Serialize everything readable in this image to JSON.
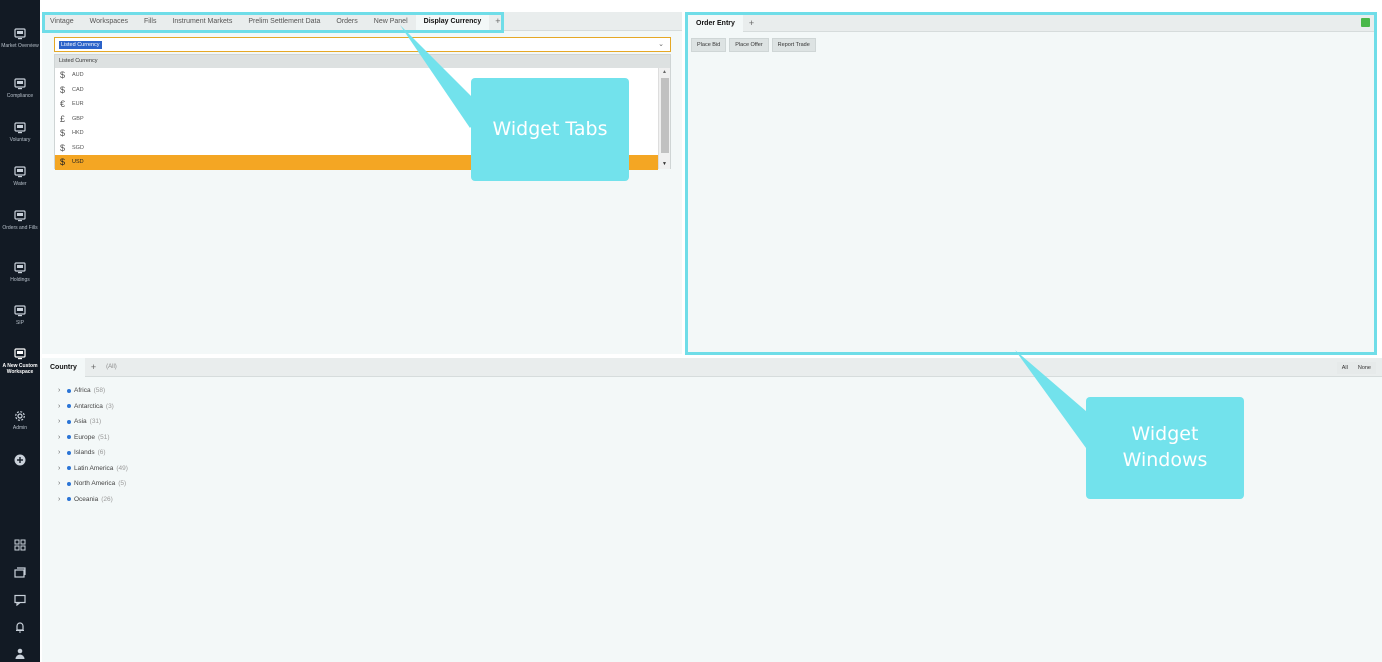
{
  "sidebar": {
    "items": [
      {
        "label": "Market Overview",
        "icon": "monitor-icon"
      },
      {
        "label": "Compliance",
        "icon": "monitor-icon"
      },
      {
        "label": "Voluntary",
        "icon": "monitor-icon"
      },
      {
        "label": "Water",
        "icon": "monitor-icon"
      },
      {
        "label": "Orders and Fills",
        "icon": "monitor-icon"
      },
      {
        "label": "Holdings",
        "icon": "monitor-icon"
      },
      {
        "label": "SIP",
        "icon": "monitor-icon"
      },
      {
        "label": "A New Custom Workspace",
        "icon": "monitor-icon",
        "active": true
      },
      {
        "label": "Admin",
        "icon": "gear-icon"
      }
    ],
    "bottom_icons": [
      "grid-icon",
      "windows-icon",
      "chat-icon",
      "bell-icon",
      "user-icon"
    ]
  },
  "left_panel": {
    "tabs": [
      "Vintage",
      "Workspaces",
      "Fills",
      "Instrument Markets",
      "Prelim Settlement Data",
      "Orders",
      "New Panel",
      "Display Currency"
    ],
    "active_tab": "Display Currency",
    "add_tab": "+",
    "select_value": "Listed Currency",
    "dropdown_header": "Listed Currency",
    "options": [
      {
        "symbol": "$",
        "code": "AUD"
      },
      {
        "symbol": "$",
        "code": "CAD"
      },
      {
        "symbol": "€",
        "code": "EUR"
      },
      {
        "symbol": "£",
        "code": "GBP"
      },
      {
        "symbol": "$",
        "code": "HKD"
      },
      {
        "symbol": "$",
        "code": "SGD"
      },
      {
        "symbol": "$",
        "code": "USD",
        "selected": true
      }
    ]
  },
  "right_panel": {
    "tab": "Order Entry",
    "add_tab": "+",
    "buttons": [
      "Place Bid",
      "Place Offer",
      "Report Trade"
    ]
  },
  "bottom_panel": {
    "tab": "Country",
    "add_tab": "+",
    "all_count": "(All)",
    "all_label": "All",
    "none_label": "None",
    "regions": [
      {
        "name": "Africa",
        "count": "(58)"
      },
      {
        "name": "Antarctica",
        "count": "(3)"
      },
      {
        "name": "Asia",
        "count": "(31)"
      },
      {
        "name": "Europe",
        "count": "(51)"
      },
      {
        "name": "Islands",
        "count": "(6)"
      },
      {
        "name": "Latin America",
        "count": "(49)"
      },
      {
        "name": "North America",
        "count": "(5)"
      },
      {
        "name": "Oceania",
        "count": "(26)"
      }
    ]
  },
  "callouts": {
    "tabs": "Widget Tabs",
    "windows": "Widget Windows"
  },
  "colors": {
    "highlight": "#6fdde8",
    "sidebar": "#121a24",
    "selected": "#f4a623",
    "callout": "#72e2ec"
  }
}
